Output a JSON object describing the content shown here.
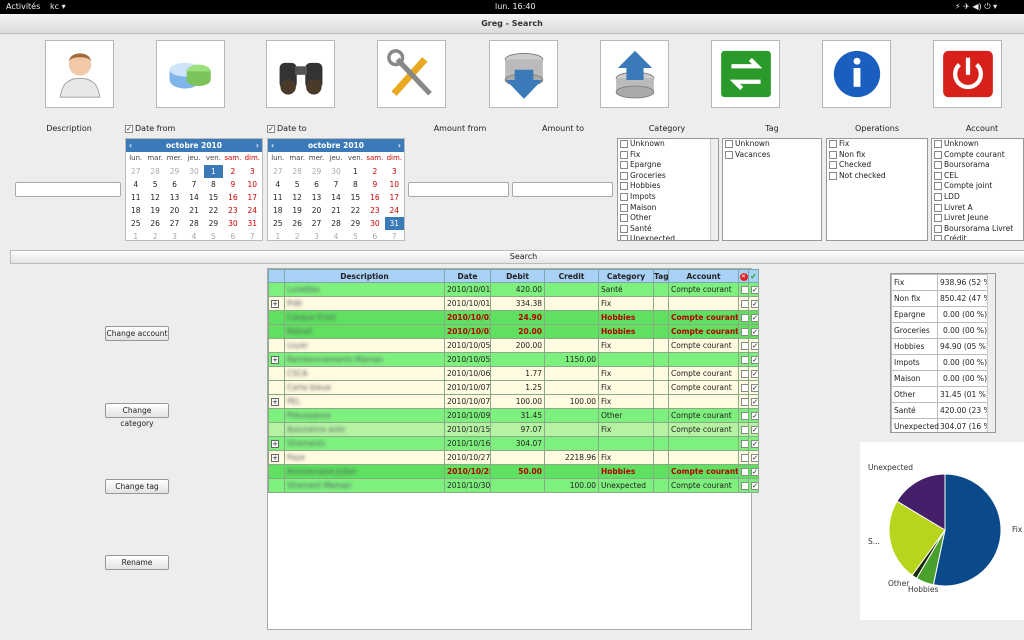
{
  "topbar": {
    "activities": "Activités",
    "app": "kc ▾",
    "clock": "lun. 16:40",
    "status": "⚡ ✈ ◀) ⏻ ▾"
  },
  "window": {
    "title": "Greg - Search"
  },
  "toolbar": [
    {
      "name": "user-icon"
    },
    {
      "name": "database-icon"
    },
    {
      "name": "binoculars-icon"
    },
    {
      "name": "tools-icon"
    },
    {
      "name": "database-download-icon"
    },
    {
      "name": "database-upload-icon"
    },
    {
      "name": "transfer-icon"
    },
    {
      "name": "info-icon"
    },
    {
      "name": "power-icon"
    }
  ],
  "filters": {
    "description_label": "Description",
    "date_from_label": "Date from",
    "date_to_label": "Date to",
    "amount_from_label": "Amount from",
    "amount_to_label": "Amount to",
    "category_label": "Category",
    "tag_label": "Tag",
    "operations_label": "Operations",
    "account_label": "Account",
    "description_value": "",
    "amount_from_value": "",
    "amount_to_value": ""
  },
  "calendar": {
    "month": "octobre",
    "year": "2010",
    "dow": [
      "lun.",
      "mar.",
      "mer.",
      "jeu.",
      "ven.",
      "sam.",
      "dim."
    ],
    "weeks": [
      [
        "27",
        "28",
        "29",
        "30",
        "1",
        "2",
        "3"
      ],
      [
        "4",
        "5",
        "6",
        "7",
        "8",
        "9",
        "10"
      ],
      [
        "11",
        "12",
        "13",
        "14",
        "15",
        "16",
        "17"
      ],
      [
        "18",
        "19",
        "20",
        "21",
        "22",
        "23",
        "24"
      ],
      [
        "25",
        "26",
        "27",
        "28",
        "29",
        "30",
        "31"
      ],
      [
        "1",
        "2",
        "3",
        "4",
        "5",
        "6",
        "7"
      ]
    ],
    "from_selected": "1",
    "to_selected": "31"
  },
  "lists": {
    "category": [
      "Unknown",
      "Fix",
      "Epargne",
      "Groceries",
      "Hobbies",
      "Impots",
      "Maison",
      "Other",
      "Santé",
      "Unexpected"
    ],
    "tag": [
      "Unknown",
      "Vacances"
    ],
    "operations": [
      "Fix",
      "Non fix",
      "Checked",
      "Not checked"
    ],
    "account": [
      "Unknown",
      "Compte courant",
      "Boursorama",
      "CEL",
      "Compte joint",
      "LDD",
      "Livret A",
      "Livret Jeune",
      "Boursorama Livret",
      "Crédit"
    ]
  },
  "search_label": "Search",
  "side_buttons": [
    "Change account",
    "Change category",
    "Change tag",
    "Rename"
  ],
  "table": {
    "headers": [
      "Description",
      "Date",
      "Debit",
      "Credit",
      "Category",
      "Tag",
      "Account"
    ],
    "rows": [
      {
        "desc": "Lunettes",
        "date": "2010/10/01",
        "debit": "420.00",
        "credit": "",
        "cat": "Santé",
        "acc": "Compte courant",
        "style": "r-a",
        "plus": false,
        "bold": false,
        "check": true
      },
      {
        "desc": "Prêt",
        "date": "2010/10/01",
        "debit": "334.38",
        "credit": "",
        "cat": "Fix",
        "acc": "",
        "style": "r-y",
        "plus": true,
        "bold": false,
        "check": true
      },
      {
        "desc": "Casque Frost",
        "date": "2010/10/02",
        "debit": "24.90",
        "credit": "",
        "cat": "Hobbies",
        "acc": "Compte courant",
        "style": "r-c",
        "plus": false,
        "bold": true,
        "check": true
      },
      {
        "desc": "Retrait",
        "date": "2010/10/02",
        "debit": "20.00",
        "credit": "",
        "cat": "Hobbies",
        "acc": "Compte courant",
        "style": "r-c",
        "plus": false,
        "bold": true,
        "check": true
      },
      {
        "desc": "Loyer",
        "date": "2010/10/05",
        "debit": "200.00",
        "credit": "",
        "cat": "Fix",
        "acc": "Compte courant",
        "style": "r-y",
        "plus": false,
        "bold": false,
        "check": true
      },
      {
        "desc": "Remboursements Maman",
        "date": "2010/10/05",
        "debit": "",
        "credit": "1150.00",
        "cat": "",
        "acc": "",
        "style": "r-a",
        "plus": true,
        "bold": false,
        "check": true
      },
      {
        "desc": "CSCA",
        "date": "2010/10/06",
        "debit": "1.77",
        "credit": "",
        "cat": "Fix",
        "acc": "Compte courant",
        "style": "r-y",
        "plus": false,
        "bold": false,
        "check": true
      },
      {
        "desc": "Carte bleue",
        "date": "2010/10/07",
        "debit": "1.25",
        "credit": "",
        "cat": "Fix",
        "acc": "Compte courant",
        "style": "r-y",
        "plus": false,
        "bold": false,
        "check": true
      },
      {
        "desc": "PEL",
        "date": "2010/10/07",
        "debit": "100.00",
        "credit": "100.00",
        "cat": "Fix",
        "acc": "",
        "style": "r-y",
        "plus": true,
        "bold": false,
        "check": true
      },
      {
        "desc": "Prévoyance",
        "date": "2010/10/09",
        "debit": "31.45",
        "credit": "",
        "cat": "Other",
        "acc": "Compte courant",
        "style": "r-a",
        "plus": false,
        "bold": false,
        "check": true
      },
      {
        "desc": "Assurance auto",
        "date": "2010/10/15",
        "debit": "97.07",
        "credit": "",
        "cat": "Fix",
        "acc": "Compte courant",
        "style": "r-b",
        "plus": false,
        "bold": false,
        "check": true
      },
      {
        "desc": "Virements",
        "date": "2010/10/16",
        "debit": "304.07",
        "credit": "",
        "cat": "",
        "acc": "",
        "style": "r-a",
        "plus": true,
        "bold": false,
        "check": true
      },
      {
        "desc": "Paye",
        "date": "2010/10/27",
        "debit": "",
        "credit": "2218.96",
        "cat": "Fix",
        "acc": "",
        "style": "r-y",
        "plus": true,
        "bold": false,
        "check": true
      },
      {
        "desc": "Anniversaire Julien",
        "date": "2010/10/28",
        "debit": "50.00",
        "credit": "",
        "cat": "Hobbies",
        "acc": "Compte courant",
        "style": "r-c",
        "plus": false,
        "bold": true,
        "check": true
      },
      {
        "desc": "Virement Maman",
        "date": "2010/10/30",
        "debit": "",
        "credit": "100.00",
        "cat": "Unexpected",
        "acc": "Compte courant",
        "style": "r-a",
        "plus": false,
        "bold": false,
        "check": true
      }
    ]
  },
  "stats": [
    {
      "cat": "Fix",
      "val": "938.96 (52 %)"
    },
    {
      "cat": "Non fix",
      "val": "850.42 (47 %)"
    },
    {
      "cat": "Epargne",
      "val": "0.00 (00 %)"
    },
    {
      "cat": "Groceries",
      "val": "0.00 (00 %)"
    },
    {
      "cat": "Hobbies",
      "val": "94.90 (05 %)"
    },
    {
      "cat": "Impots",
      "val": "0.00 (00 %)"
    },
    {
      "cat": "Maison",
      "val": "0.00 (00 %)"
    },
    {
      "cat": "Other",
      "val": "31.45 (01 %)"
    },
    {
      "cat": "Santé",
      "val": "420.00 (23 %)"
    },
    {
      "cat": "Unexpected",
      "val": "304.07 (16 %)"
    }
  ],
  "chart_data": {
    "type": "pie",
    "slices": [
      {
        "label": "Fix",
        "value": 52,
        "color": "#0a4a8a"
      },
      {
        "label": "Hobbies",
        "value": 5,
        "color": "#4aa02c"
      },
      {
        "label": "Other",
        "value": 1.5,
        "color": "#1a2a10"
      },
      {
        "label": "S...",
        "value": 23,
        "color": "#b8d41c"
      },
      {
        "label": "Unexpected",
        "value": 16,
        "color": "#44206a"
      }
    ]
  }
}
